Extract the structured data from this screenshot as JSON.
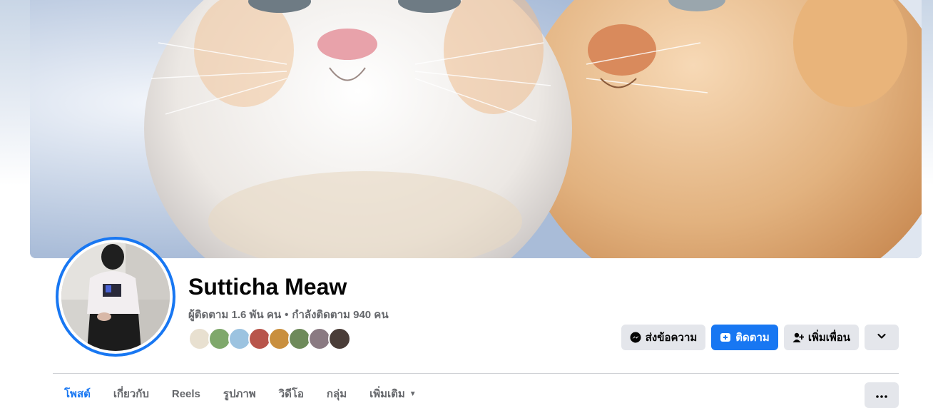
{
  "profile": {
    "name": "Sutticha Meaw",
    "followers_text": "ผู้ติดตาม 1.6 พัน คน",
    "separator": "•",
    "following_text": "กำลังติดตาม 940 คน"
  },
  "friends": [
    {
      "color": "#e8e0d0"
    },
    {
      "color": "#7fa86b"
    },
    {
      "color": "#9cc3e0"
    },
    {
      "color": "#b8554b"
    },
    {
      "color": "#c98f3e"
    },
    {
      "color": "#6e8a5a"
    },
    {
      "color": "#8a7a82"
    },
    {
      "color": "#4a3d38"
    }
  ],
  "actions": {
    "message_label": "ส่งข้อความ",
    "follow_label": "ติดตาม",
    "add_friend_label": "เพิ่มเพื่อน",
    "dropdown_icon": "chevron-down-icon"
  },
  "tabs": [
    {
      "label": "โพสต์",
      "active": true
    },
    {
      "label": "เกี่ยวกับ",
      "active": false
    },
    {
      "label": "Reels",
      "active": false
    },
    {
      "label": "รูปภาพ",
      "active": false
    },
    {
      "label": "วิดีโอ",
      "active": false
    },
    {
      "label": "กลุ่ม",
      "active": false
    },
    {
      "label": "เพิ่มเติม",
      "active": false
    }
  ],
  "more_menu_icon": "ellipsis-icon",
  "colors": {
    "accent": "#1877f2",
    "secondary_button": "#e4e6eb",
    "muted_text": "#65676b"
  }
}
